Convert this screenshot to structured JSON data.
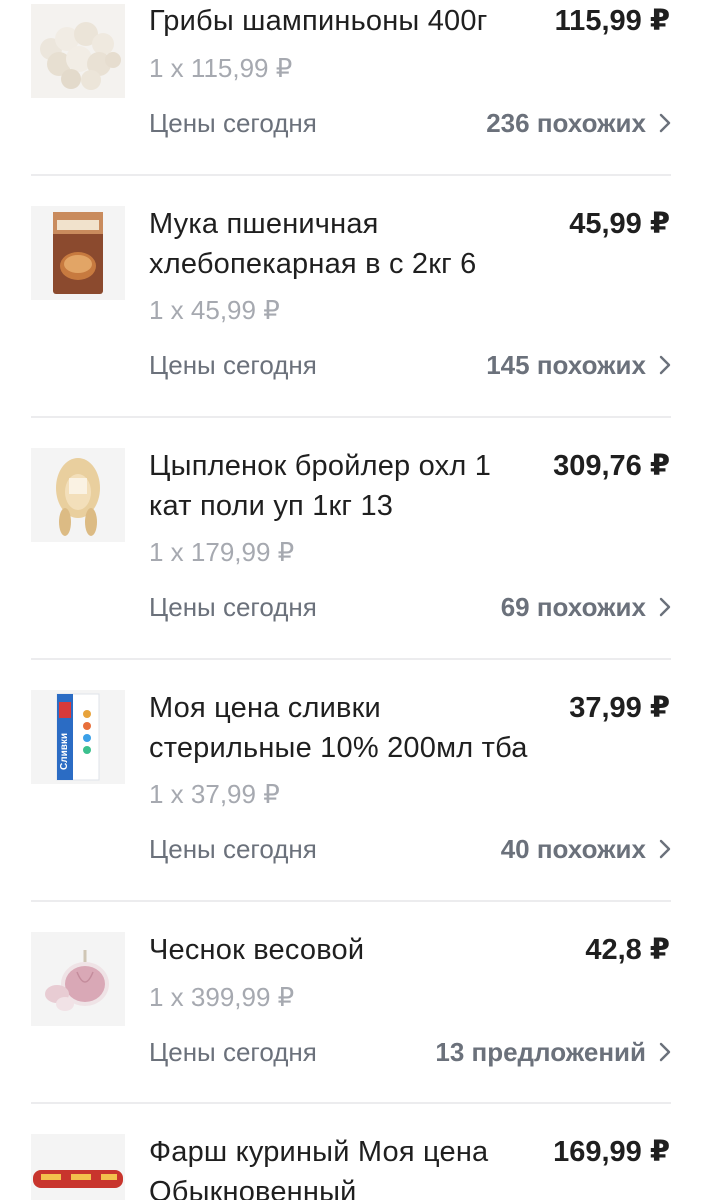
{
  "currency": "₽",
  "items": [
    {
      "name": "Грибы шампиньоны 400г",
      "price": "115,99 ₽",
      "qty": "1 x 115,99 ₽",
      "prices_today": "Цены сегодня",
      "similar": "236 похожих",
      "image_icon": "mushrooms-image"
    },
    {
      "name": "Мука пшеничная хлебопекарная в с 2кг 6",
      "price": "45,99 ₽",
      "qty": "1 x 45,99 ₽",
      "prices_today": "Цены сегодня",
      "similar": "145 похожих",
      "image_icon": "flour-bag-image"
    },
    {
      "name": "Цыпленок бройлер охл 1 кат поли уп 1кг 13",
      "price": "309,76 ₽",
      "qty": "1 x 179,99 ₽",
      "prices_today": "Цены сегодня",
      "similar": "69 похожих",
      "image_icon": "chicken-image"
    },
    {
      "name": "Моя цена сливки стерильные 10% 200мл тба",
      "price": "37,99 ₽",
      "qty": "1 x 37,99 ₽",
      "prices_today": "Цены сегодня",
      "similar": "40 похожих",
      "image_icon": "cream-carton-image",
      "carton_text": "Сливки"
    },
    {
      "name": "Чеснок весовой",
      "price": "42,8 ₽",
      "qty": "1 x 399,99 ₽",
      "prices_today": "Цены сегодня",
      "similar": "13 предложений",
      "image_icon": "garlic-image"
    },
    {
      "name": "Фарш куриный Моя цена Обыкновенный",
      "price": "169,99 ₽",
      "image_icon": "minced-meat-image"
    }
  ],
  "colors": {
    "text": "#1f1f1f",
    "muted": "#a6a9b0",
    "secondary": "#6b717b",
    "divider": "#ececee"
  }
}
